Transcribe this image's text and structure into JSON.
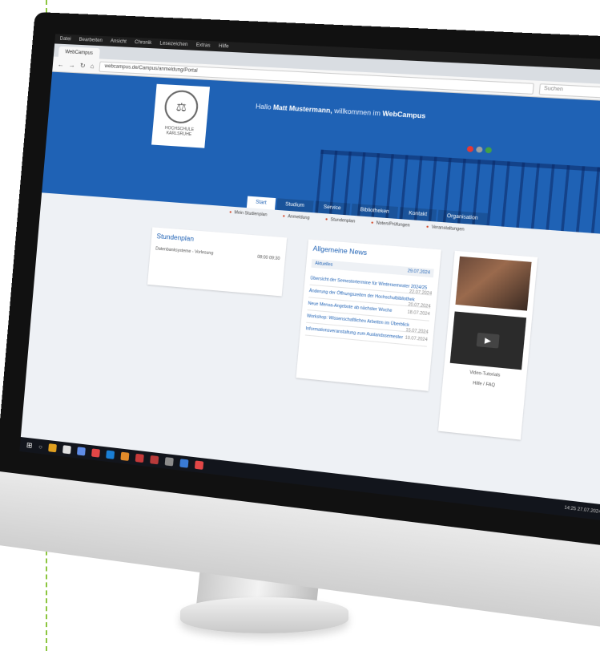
{
  "browser": {
    "menu": [
      "Datei",
      "Bearbeiten",
      "Ansicht",
      "Chronik",
      "Lesezeichen",
      "Extras",
      "Hilfe"
    ],
    "tab_label": "WebCampus",
    "url": "webcampus.de/Campus/anmeldung/Portal",
    "search_placeholder": "Suchen",
    "nav_icons": [
      "back-icon",
      "forward-icon",
      "reload-icon",
      "home-icon"
    ]
  },
  "header": {
    "greeting_prefix": "Hallo",
    "user_name": "Matt Mustermann,",
    "greeting_mid": "willkommen im",
    "site_name": "WebCampus",
    "logo_text": "HOCHSCHULE\nKARLSRUHE",
    "status_colors": [
      "#e53935",
      "#9e9e9e",
      "#43a047"
    ]
  },
  "nav": {
    "tabs": [
      "Start",
      "Studium",
      "Service",
      "Bibliotheken",
      "Kontakt",
      "Organisation"
    ],
    "active_index": 0
  },
  "quicklinks": [
    "Mein Studienplan",
    "Anmeldung",
    "Stundenplan",
    "Noten/Prüfungen",
    "Veranstaltungen"
  ],
  "courses": {
    "title": "Stundenplan",
    "rows": [
      {
        "name": "Datenbanksysteme - Vorlesung",
        "time": "08:00\n09:30"
      }
    ]
  },
  "news": {
    "title": "Allgemeine News",
    "subheader": "Aktuelles",
    "subheader_date": "29.07.2024",
    "items": [
      {
        "text": "Übersicht der Semestertermine für Wintersemester 2024/25",
        "date": "22.07.2024"
      },
      {
        "text": "Änderung der Öffnungszeiten der Hochschulbibliothek",
        "date": "20.07.2024"
      },
      {
        "text": "Neue Mensa-Angebote ab nächster Woche",
        "date": "18.07.2024"
      },
      {
        "text": "Workshop: Wissenschaftliches Arbeiten im Überblick",
        "date": "15.07.2024"
      },
      {
        "text": "Informationsveranstaltung zum Auslandssemester",
        "date": "10.07.2024"
      }
    ]
  },
  "sidebar": {
    "video_label": "Video-Tutorials",
    "help_label": "Hilfe / FAQ"
  },
  "taskbar": {
    "apps": [
      "#e0a020",
      "#e0e0e0",
      "#5f8de8",
      "#e24747",
      "#1a7fd6",
      "#e08a2a",
      "#c63a3a",
      "#b83a3a",
      "#8c8c8c",
      "#3a7bd5",
      "#e24747"
    ],
    "clock": "14:25\n27.07.2024"
  }
}
